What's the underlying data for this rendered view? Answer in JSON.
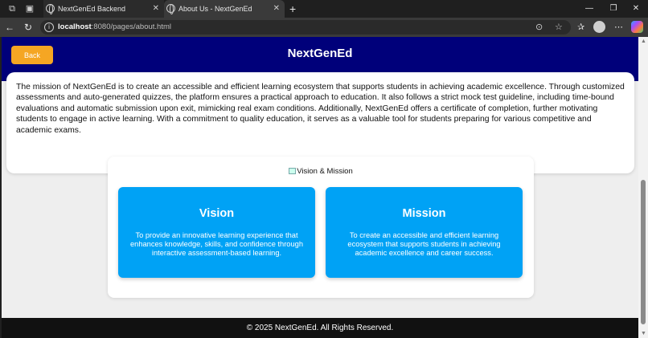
{
  "browser": {
    "tabs": [
      {
        "title": "NextGenEd Backend"
      },
      {
        "title": "About Us - NextGenEd"
      }
    ],
    "url_host": "localhost",
    "url_rest": ":8080/pages/about.html",
    "window_controls": {
      "minimize": "—",
      "restore": "❐",
      "close": "✕"
    }
  },
  "header": {
    "back_label": "Back",
    "title": "NextGenEd"
  },
  "mission_paragraph": "The mission of NextGenEd is to create an accessible and efficient learning ecosystem that supports students in achieving academic excellence. Through customized assessments and auto-generated quizzes, the platform ensures a practical approach to education. It also follows a strict mock test guideline, including time-bound evaluations and automatic submission upon exit, mimicking real exam conditions. Additionally, NextGenEd offers a certificate of completion, further motivating students to engage in active learning. With a commitment to quality education, it serves as a valuable tool for students preparing for various competitive and academic exams.",
  "vision_mission": {
    "image_alt": "Vision & Mission",
    "vision": {
      "title": "Vision",
      "text": "To provide an innovative learning experience that enhances knowledge, skills, and confidence through interactive assessment-based learning."
    },
    "mission": {
      "title": "Mission",
      "text": "To create an accessible and efficient learning ecosystem that supports students in achieving academic excellence and career success."
    }
  },
  "footer": {
    "text": "© 2025 NextGenEd. All Rights Reserved."
  }
}
